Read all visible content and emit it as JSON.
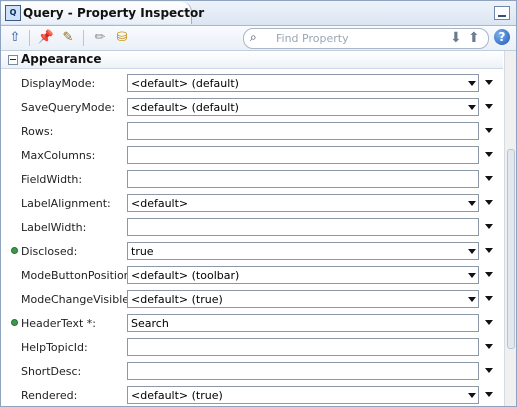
{
  "window": {
    "title": "Query - Property Inspector"
  },
  "toolbar": {
    "search_placeholder": "Find Property",
    "icons": [
      "up-arrow-icon",
      "pin-icon",
      "edit-icon",
      "pencil-icon",
      "bind-icon",
      "search-icon",
      "arrow-down-icon",
      "arrow-up-icon",
      "help-icon"
    ]
  },
  "section": {
    "title": "Appearance"
  },
  "properties": [
    {
      "label": "DisplayMode:",
      "value": "<default> (default)",
      "dropdown": true,
      "modified": false
    },
    {
      "label": "SaveQueryMode:",
      "value": "<default> (default)",
      "dropdown": true,
      "modified": false
    },
    {
      "label": "Rows:",
      "value": "",
      "dropdown": false,
      "modified": false
    },
    {
      "label": "MaxColumns:",
      "value": "",
      "dropdown": false,
      "modified": false
    },
    {
      "label": "FieldWidth:",
      "value": "",
      "dropdown": false,
      "modified": false
    },
    {
      "label": "LabelAlignment:",
      "value": "<default>",
      "dropdown": true,
      "modified": false
    },
    {
      "label": "LabelWidth:",
      "value": "",
      "dropdown": false,
      "modified": false
    },
    {
      "label": "Disclosed:",
      "value": "true",
      "dropdown": true,
      "modified": true
    },
    {
      "label": "ModeButtonPosition:",
      "value": "<default> (toolbar)",
      "dropdown": true,
      "modified": false
    },
    {
      "label": "ModeChangeVisible:",
      "value": "<default> (true)",
      "dropdown": true,
      "modified": false
    },
    {
      "label": "HeaderText *:",
      "value": "Search",
      "dropdown": false,
      "modified": true
    },
    {
      "label": "HelpTopicId:",
      "value": "",
      "dropdown": false,
      "modified": false
    },
    {
      "label": "ShortDesc:",
      "value": "",
      "dropdown": false,
      "modified": false
    },
    {
      "label": "Rendered:",
      "value": "<default> (true)",
      "dropdown": true,
      "modified": false
    }
  ]
}
